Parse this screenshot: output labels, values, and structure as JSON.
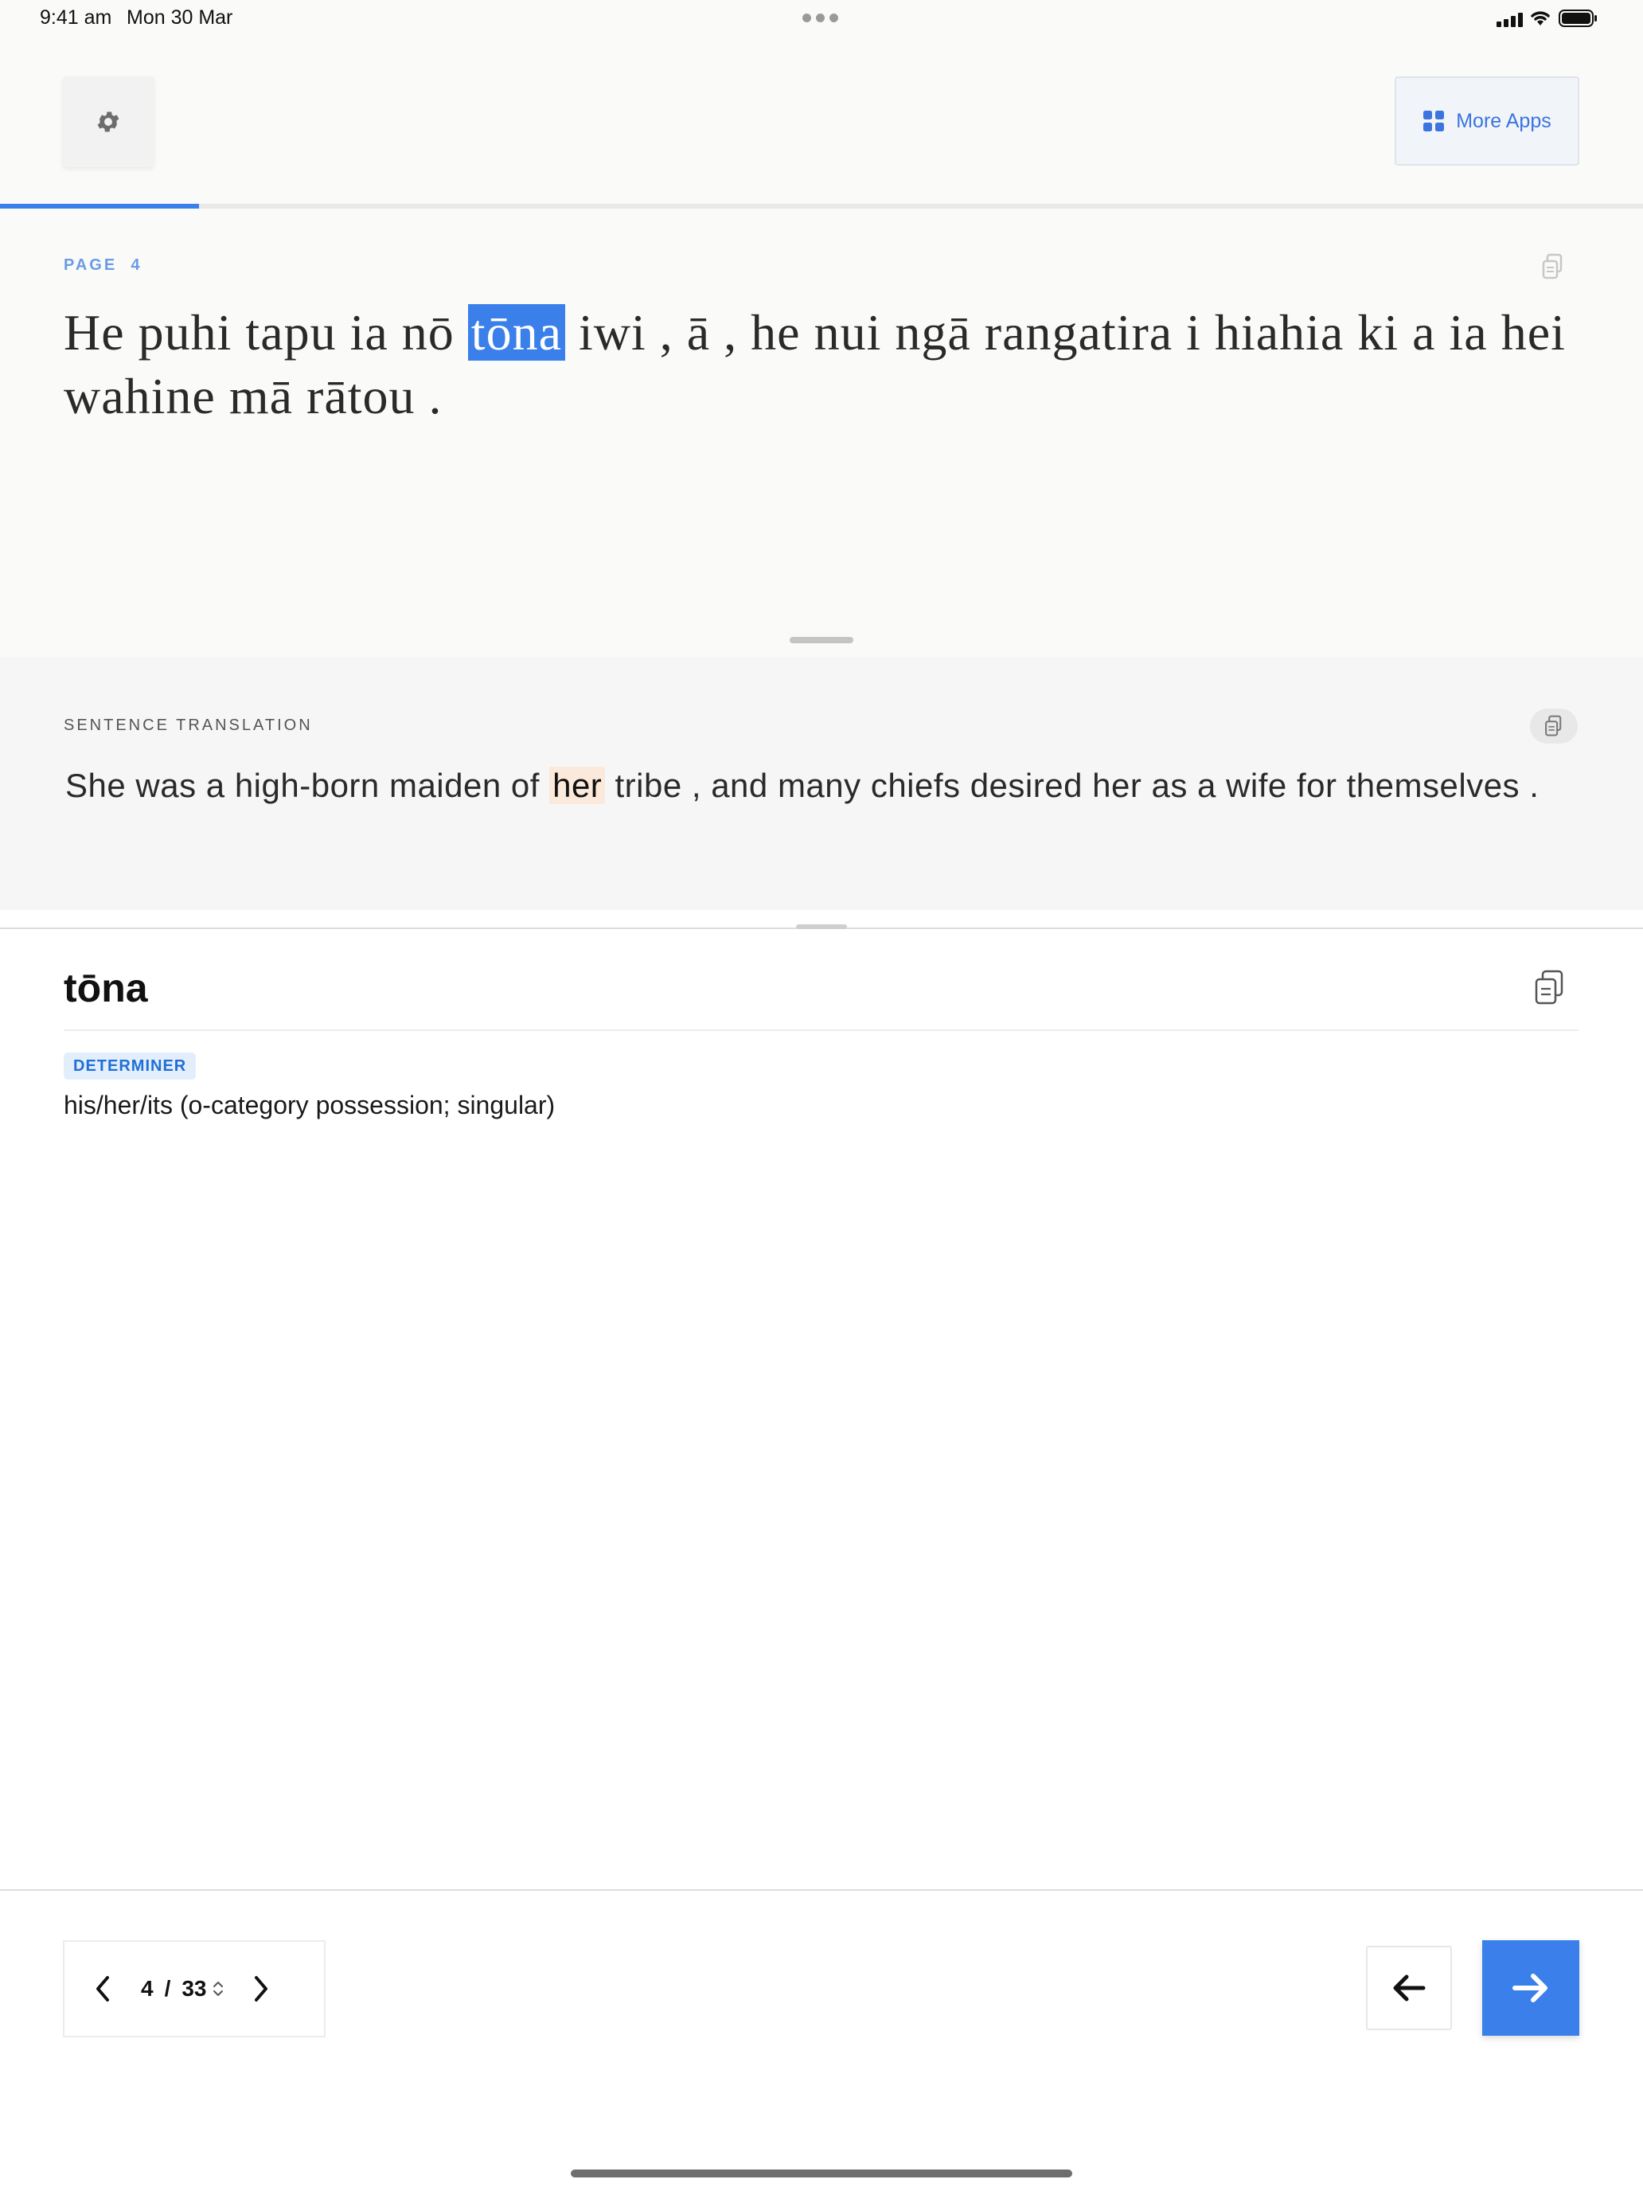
{
  "status_bar": {
    "time": "9:41 am",
    "date": "Mon 30 Mar"
  },
  "header": {
    "more_apps_label": "More Apps",
    "progress_fraction": 0.121
  },
  "reading": {
    "page_label": "PAGE",
    "page_number": "4",
    "sentence_words": [
      "He",
      "puhi",
      "tapu",
      "ia",
      "nō",
      "tōna",
      "iwi",
      ",",
      "ā",
      ",",
      "he",
      "nui",
      "ngā",
      "rangatira",
      "i",
      "hiahia",
      "ki",
      "a",
      "ia",
      "hei",
      "wahine",
      "mā",
      "rātou",
      "."
    ],
    "highlighted_word": "tōna"
  },
  "translation": {
    "label": "SENTENCE TRANSLATION",
    "words": [
      "She",
      "was",
      "a",
      "high-born",
      "maiden",
      "of",
      "her",
      "tribe",
      ",",
      "and",
      "many",
      "chiefs",
      "desired",
      "her",
      "as",
      "a",
      "wife",
      "for",
      "themselves",
      "."
    ],
    "highlighted_index": 6
  },
  "dictionary": {
    "word": "tōna",
    "part_of_speech": "DETERMINER",
    "definition": "his/her/its (o-category possession; singular)"
  },
  "pager": {
    "current": "4",
    "separator": "/",
    "total": "33"
  },
  "colors": {
    "accent": "#3b80ea",
    "highlight_translation": "#fbeadc",
    "badge_bg": "#e3eefc"
  },
  "icons": {
    "settings": "gear-icon",
    "more_apps": "grid-icon",
    "copy": "copy-icon",
    "prev_page": "chevron-left-icon",
    "next_page": "chevron-right-icon",
    "stepper": "chevron-updown-icon",
    "back": "arrow-left-icon",
    "forward": "arrow-right-icon"
  }
}
